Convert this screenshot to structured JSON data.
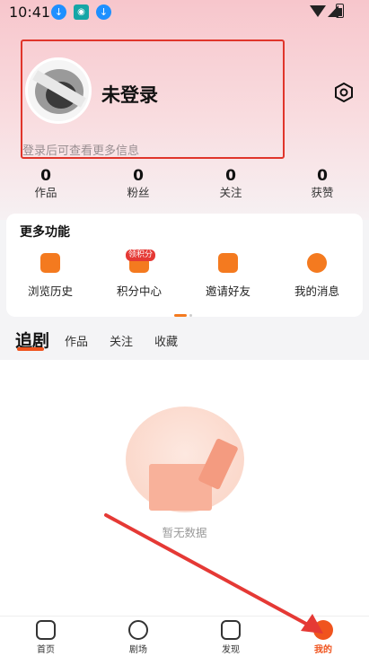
{
  "status_bar": {
    "time": "10:41"
  },
  "profile": {
    "nickname": "未登录",
    "login_hint": "登录后可查看更多信息"
  },
  "stats": [
    {
      "count": "0",
      "label": "作品"
    },
    {
      "count": "0",
      "label": "粉丝"
    },
    {
      "count": "0",
      "label": "关注"
    },
    {
      "count": "0",
      "label": "获赞"
    }
  ],
  "more_functions": {
    "title": "更多功能",
    "items": [
      {
        "label": "浏览历史",
        "icon": "history-icon"
      },
      {
        "label": "积分中心",
        "icon": "points-icon",
        "badge": "领积分"
      },
      {
        "label": "邀请好友",
        "icon": "invite-icon"
      },
      {
        "label": "我的消息",
        "icon": "message-icon"
      }
    ]
  },
  "tabs": [
    {
      "label": "追剧",
      "active": true
    },
    {
      "label": "作品"
    },
    {
      "label": "关注"
    },
    {
      "label": "收藏"
    }
  ],
  "empty_state": {
    "text": "暂无数据"
  },
  "bottom_nav": [
    {
      "label": "首页",
      "icon": "home-icon"
    },
    {
      "label": "剧场",
      "icon": "theater-icon"
    },
    {
      "label": "发现",
      "icon": "discover-icon"
    },
    {
      "label": "我的",
      "icon": "mine-icon",
      "active": true
    }
  ],
  "colors": {
    "accent": "#f0541e",
    "highlight_border": "#e0352b",
    "annotation_arrow": "#e53935"
  }
}
